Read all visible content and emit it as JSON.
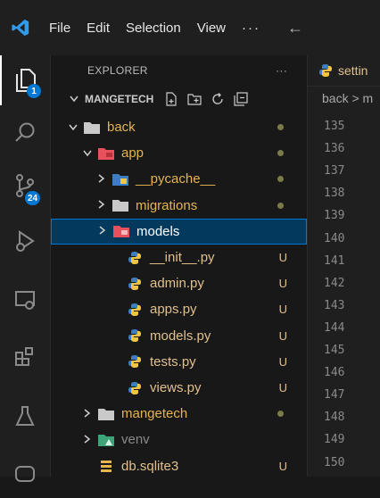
{
  "menu": {
    "file": "File",
    "edit": "Edit",
    "selection": "Selection",
    "view": "View",
    "more": "···",
    "back": "←"
  },
  "activity": {
    "explorer_badge": "1",
    "scm_badge": "24"
  },
  "explorer": {
    "title": "EXPLORER",
    "more": "···",
    "project": "MANGETECH",
    "tree": [
      {
        "label": "back",
        "type": "folder",
        "expanded": true,
        "color": "#e6b450",
        "deco": "dot"
      },
      {
        "label": "app",
        "type": "folder-app",
        "expanded": true,
        "color": "#e6b450",
        "deco": "dot"
      },
      {
        "label": "__pycache__",
        "type": "folder-py",
        "expanded": false,
        "color": "#e6b450",
        "deco": "dot"
      },
      {
        "label": "migrations",
        "type": "folder",
        "expanded": false,
        "color": "#e6b450",
        "deco": "dot"
      },
      {
        "label": "models",
        "type": "folder-models",
        "expanded": false,
        "color": "#ffffff",
        "deco": ""
      },
      {
        "label": "__init__.py",
        "type": "python",
        "color": "#e2c08d",
        "deco": "U"
      },
      {
        "label": "admin.py",
        "type": "python",
        "color": "#e2c08d",
        "deco": "U"
      },
      {
        "label": "apps.py",
        "type": "python",
        "color": "#e2c08d",
        "deco": "U"
      },
      {
        "label": "models.py",
        "type": "python",
        "color": "#e2c08d",
        "deco": "U"
      },
      {
        "label": "tests.py",
        "type": "python",
        "color": "#e2c08d",
        "deco": "U"
      },
      {
        "label": "views.py",
        "type": "python",
        "color": "#e2c08d",
        "deco": "U"
      },
      {
        "label": "mangetech",
        "type": "folder",
        "expanded": false,
        "color": "#e6b450",
        "deco": "dot"
      },
      {
        "label": "venv",
        "type": "folder-venv",
        "expanded": false,
        "color": "#8a8a8a",
        "deco": ""
      },
      {
        "label": "db.sqlite3",
        "type": "db",
        "color": "#e2c08d",
        "deco": "U"
      }
    ]
  },
  "editor": {
    "tab_label": "settin",
    "breadcrumb": "back > m",
    "line_numbers": [
      "135",
      "136",
      "137",
      "138",
      "139",
      "140",
      "141",
      "142",
      "143",
      "144",
      "145",
      "146",
      "147",
      "148",
      "149",
      "150"
    ]
  }
}
